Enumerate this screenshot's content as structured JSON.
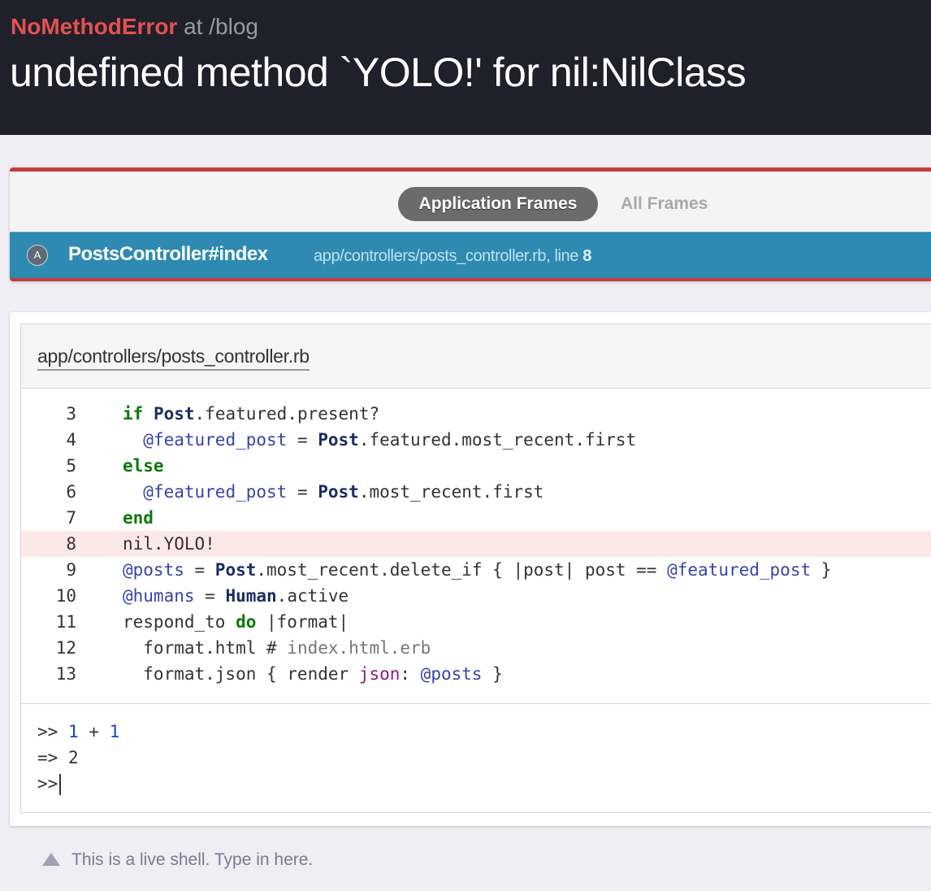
{
  "error": {
    "name": "NoMethodError",
    "at": "at /blog",
    "message": "undefined method `YOLO!' for nil:NilClass"
  },
  "frames": {
    "tabs": {
      "application": "Application Frames",
      "all": "All Frames"
    },
    "selected": {
      "badge": "A",
      "method": "PostsController#index",
      "location": "app/controllers/posts_controller.rb, line",
      "line": "8"
    }
  },
  "source": {
    "file": "app/controllers/posts_controller.rb",
    "highlight_line": 8,
    "lines": [
      {
        "num": "3",
        "text": "if Post.featured.present?"
      },
      {
        "num": "4",
        "text": "  @featured_post = Post.featured.most_recent.first"
      },
      {
        "num": "5",
        "text": "else"
      },
      {
        "num": "6",
        "text": "  @featured_post = Post.most_recent.first"
      },
      {
        "num": "7",
        "text": "end"
      },
      {
        "num": "8",
        "text": "nil.YOLO!"
      },
      {
        "num": "9",
        "text": "@posts = Post.most_recent.delete_if { |post| post == @featured_post }"
      },
      {
        "num": "10",
        "text": "@humans = Human.active"
      },
      {
        "num": "11",
        "text": "respond_to do |format|"
      },
      {
        "num": "12",
        "text": "  format.html # index.html.erb"
      },
      {
        "num": "13",
        "text": "  format.json { render json: @posts }"
      }
    ]
  },
  "console": {
    "prompt": ">>",
    "result_prefix": "=>",
    "input_a": "1",
    "operator": "+",
    "input_b": "1",
    "output": "2"
  },
  "hint": "This is a live shell. Type in here."
}
